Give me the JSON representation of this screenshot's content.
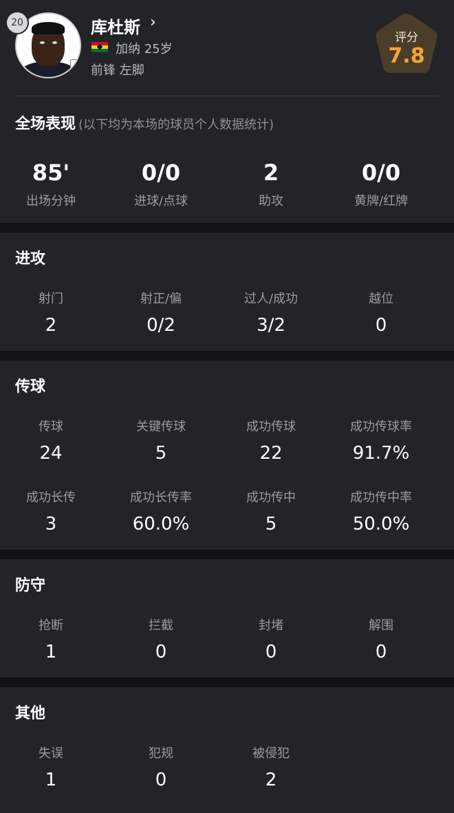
{
  "player": {
    "number": "20",
    "name": "库杜斯",
    "chevron": "›",
    "nation_age": "加纳 25岁",
    "position_foot": "前锋  左脚",
    "flag_icon": "ghana-flag-icon",
    "club_icon": "tottenham-crest-icon"
  },
  "rating": {
    "label": "评分",
    "value": "7.8",
    "accent": "#f4a534",
    "badge_color": "#4a3d2a"
  },
  "overall": {
    "title": "全场表现",
    "subtitle": "(以下均为本场的球员个人数据统计)",
    "stats": [
      {
        "value": "85'",
        "label": "出场分钟"
      },
      {
        "value": "0/0",
        "label": "进球/点球"
      },
      {
        "value": "2",
        "label": "助攻"
      },
      {
        "value": "0/0",
        "label": "黄牌/红牌"
      }
    ]
  },
  "attack": {
    "title": "进攻",
    "stats": [
      {
        "label": "射门",
        "value": "2"
      },
      {
        "label": "射正/偏",
        "value": "0/2"
      },
      {
        "label": "过人/成功",
        "value": "3/2"
      },
      {
        "label": "越位",
        "value": "0"
      }
    ]
  },
  "passing": {
    "title": "传球",
    "row1": [
      {
        "label": "传球",
        "value": "24"
      },
      {
        "label": "关键传球",
        "value": "5"
      },
      {
        "label": "成功传球",
        "value": "22"
      },
      {
        "label": "成功传球率",
        "value": "91.7%"
      }
    ],
    "row2": [
      {
        "label": "成功长传",
        "value": "3"
      },
      {
        "label": "成功长传率",
        "value": "60.0%"
      },
      {
        "label": "成功传中",
        "value": "5"
      },
      {
        "label": "成功传中率",
        "value": "50.0%"
      }
    ]
  },
  "defense": {
    "title": "防守",
    "stats": [
      {
        "label": "抢断",
        "value": "1"
      },
      {
        "label": "拦截",
        "value": "0"
      },
      {
        "label": "封堵",
        "value": "0"
      },
      {
        "label": "解围",
        "value": "0"
      }
    ]
  },
  "other": {
    "title": "其他",
    "stats": [
      {
        "label": "失误",
        "value": "1"
      },
      {
        "label": "犯规",
        "value": "0"
      },
      {
        "label": "被侵犯",
        "value": "2"
      }
    ]
  }
}
